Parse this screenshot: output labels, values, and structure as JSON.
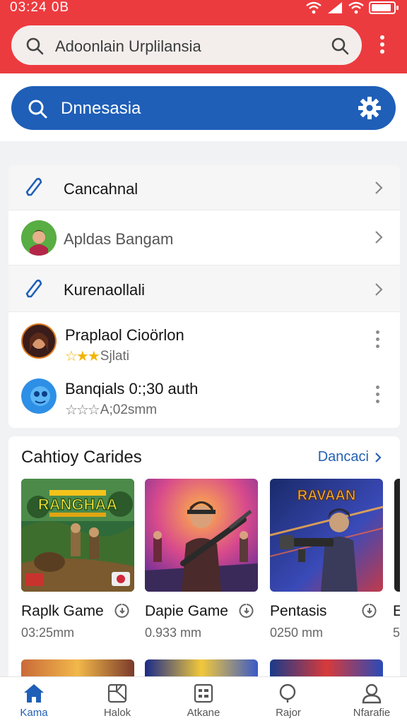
{
  "status_bar": {
    "time": "03:24 0B",
    "battery_level": 0.9
  },
  "header": {
    "search_placeholder": "Adoonlain Urplilansia",
    "search_icon": "search-icon",
    "more_icon": "more-vertical-icon"
  },
  "primary_search": {
    "text": "Dnnesasia",
    "icon": "search-icon",
    "settings_icon": "gear-icon"
  },
  "list": {
    "rows": [
      {
        "label": "Cancahnal",
        "icon": "edit-icon"
      },
      {
        "label": "Apldas Bangam",
        "icon": "avatar"
      },
      {
        "label": "Kurenaollali",
        "icon": "edit-icon"
      }
    ],
    "apps": [
      {
        "title": "Praplaol Cioörlon",
        "rating_text": "Sjlati",
        "stars": 3
      },
      {
        "title": "Banqials 0:;30 auth",
        "rating_text": "A;02smm",
        "stars": 3
      }
    ]
  },
  "games_section": {
    "title": "Cahtioy Carides",
    "link": "Dancaci",
    "games": [
      {
        "name": "Raplk Game",
        "size": "03:25mm",
        "art_title": "RANGHAA"
      },
      {
        "name": "Dapie Game",
        "size": "0.933 mm",
        "art_title": ""
      },
      {
        "name": "Pentasis",
        "size": "0250 mm",
        "art_title": "RAVAAN"
      }
    ],
    "partial_label": "E",
    "partial_size": "5"
  },
  "bottom_nav": [
    {
      "label": "Kama",
      "icon": "home-icon",
      "active": true
    },
    {
      "label": "Halok",
      "icon": "map-icon",
      "active": false
    },
    {
      "label": "Atkane",
      "icon": "grid-icon",
      "active": false
    },
    {
      "label": "Rajor",
      "icon": "search-icon",
      "active": false
    },
    {
      "label": "Nfarafie",
      "icon": "profile-icon",
      "active": false
    }
  ],
  "colors": {
    "header_red": "#ec3b3f",
    "primary_blue": "#1f5fb8",
    "accent_link": "#2461b3"
  }
}
